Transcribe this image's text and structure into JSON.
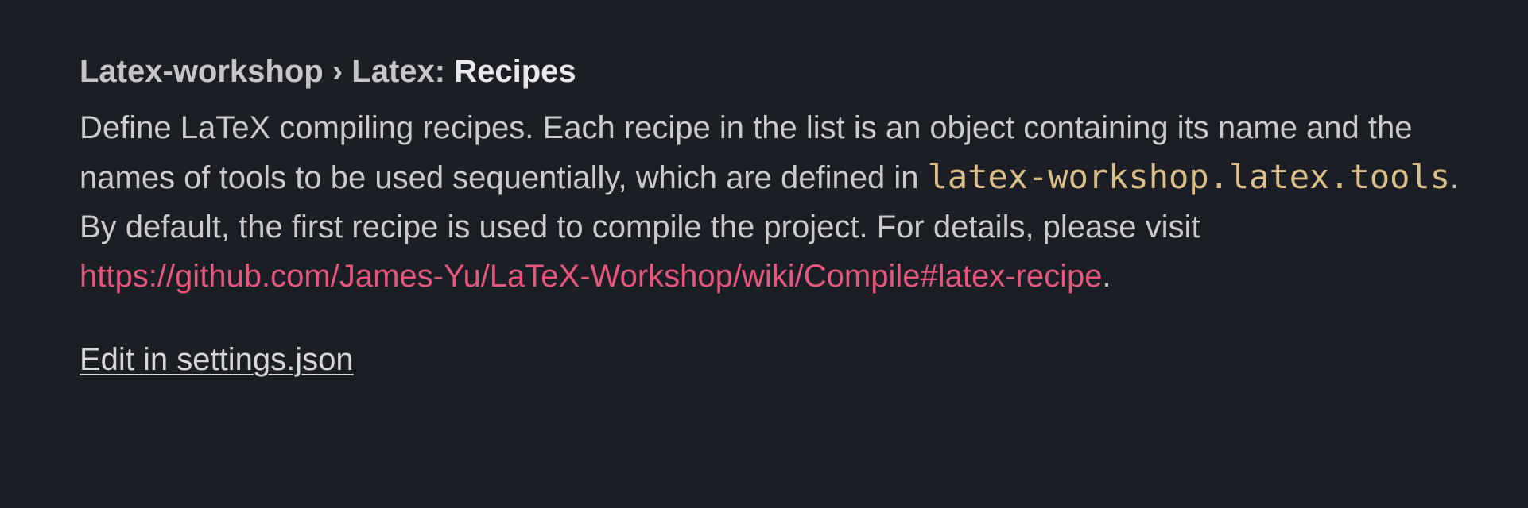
{
  "setting": {
    "category": "Latex-workshop › Latex: ",
    "name": "Recipes",
    "description": {
      "part1": "Define LaTeX compiling recipes. Each recipe in the list is an object containing its name and the names of tools to be used sequentially, which are defined in ",
      "code": "latex-workshop.latex.tools",
      "part2": ". By default, the first recipe is used to compile the project. For details, please visit ",
      "link": "https://github.com/James-Yu/LaTeX-Workshop/wiki/Compile#latex-recipe",
      "part3": "."
    },
    "edit_label": "Edit in settings.json"
  },
  "colors": {
    "background": "#1c1e25",
    "text": "#c9cbd1",
    "code": "#dcc08a",
    "link": "#e6577c"
  }
}
